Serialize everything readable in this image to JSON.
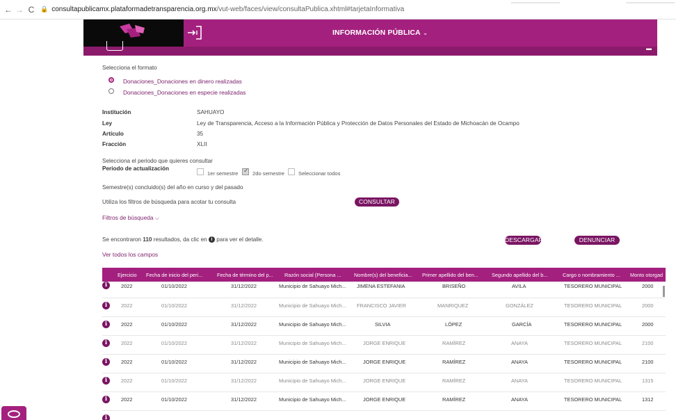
{
  "browser": {
    "url_host": "consultapublicamx.plataformadetransparencia.org.mx",
    "url_path": "/vut-web/faces/view/consultaPublica.xhtml#tarjetaInformativa"
  },
  "header": {
    "menu_title": "INFORMACIÓN PÚBLICA",
    "colors": {
      "primary": "#a3207e",
      "dark": "#7a1563"
    }
  },
  "format": {
    "label": "Selecciona el formato",
    "options": [
      {
        "label": "Donaciones_Donaciones en dinero realizadas",
        "selected": true
      },
      {
        "label": "Donaciones_Donaciones en especie realizadas",
        "selected": false
      }
    ]
  },
  "details": [
    {
      "key": "Institución",
      "value": "SAHUAYO"
    },
    {
      "key": "Ley",
      "value": "Ley de Transparencia, Acceso a la Información Pública y Protección de Datos Personales del Estado de Michoacán de Ocampo"
    },
    {
      "key": "Artículo",
      "value": "35"
    },
    {
      "key": "Fracción",
      "value": "XLII"
    }
  ],
  "period": {
    "prompt": "Selecciona el periodo que quieres consultar",
    "label": "Periodo de actualización",
    "options": [
      {
        "label": "1er semestre",
        "checked": false
      },
      {
        "label": "2do semestre",
        "checked": true
      },
      {
        "label": "Seleccionar todos",
        "checked": false
      }
    ],
    "note": "Semestre(s) concluido(s) del año en curso y del pasado"
  },
  "filters": {
    "hint": "Utiliza los filtros de búsqueda para acotar tu consulta",
    "consultar_label": "CONSULTAR",
    "toggle_label": "Filtros de búsqueda"
  },
  "results": {
    "prefix": "Se encontraron",
    "count": "110",
    "middle": "resultados, da clic en",
    "suffix": "para ver el detalle.",
    "descargar_label": "DESCARGAR",
    "denunciar_label": "DENUNCIAR",
    "ver_todos_label": "Ver todos los campos"
  },
  "table": {
    "columns": [
      "Ejercicio",
      "Fecha de inicio del peri...",
      "Fecha de término del p...",
      "Razón social (Persona ...",
      "Nombre(s) del beneficia...",
      "Primer apellido del ben...",
      "Segundo apellido del b...",
      "Cargo o nombramiento ...",
      "Monto otorgad"
    ],
    "rows": [
      [
        "2022",
        "01/10/2022",
        "31/12/2022",
        "Municipio de Sahuayo Mich...",
        "JIMENA ESTEFANIA",
        "BRISEÑO",
        "AVILA",
        "TESORERO MUNICIPAL",
        "2000"
      ],
      [
        "2022",
        "01/10/2022",
        "31/12/2022",
        "Municipio de Sahuayo Mich...",
        "FRANCISCO JAVIER",
        "MANRIQUEZ",
        "GONZÁLEZ",
        "TESORERO MUNICIPAL",
        "2000"
      ],
      [
        "2022",
        "01/10/2022",
        "31/12/2022",
        "Municipio de Sahuayo Mich...",
        "SILVIA",
        "LÓPEZ",
        "GARCÍA",
        "TESORERO MUNICIPAL",
        "2000"
      ],
      [
        "2022",
        "01/10/2022",
        "31/12/2022",
        "Municipio de Sahuayo Mich...",
        "JORGE ENRIQUE",
        "RAMÍREZ",
        "ANAYA",
        "TESORERO MUNICIPAL",
        "2100"
      ],
      [
        "2022",
        "01/10/2022",
        "31/12/2022",
        "Municipio de Sahuayo Mich...",
        "JORGE ENRIQUE",
        "RAMÍREZ",
        "ANAYA",
        "TESORERO MUNICIPAL",
        "2100"
      ],
      [
        "2022",
        "01/10/2022",
        "31/12/2022",
        "Municipio de Sahuayo Mich...",
        "JORGE ENRIQUE",
        "RAMÍREZ",
        "ANAYA",
        "TESORERO MUNICIPAL",
        "1315"
      ],
      [
        "2022",
        "01/10/2022",
        "31/12/2022",
        "Municipio de Sahuayo Mich...",
        "JORGE ENRIQUE",
        "RAMÍREZ",
        "ANAYA",
        "TESORERO MUNICIPAL",
        "1312"
      ]
    ]
  }
}
